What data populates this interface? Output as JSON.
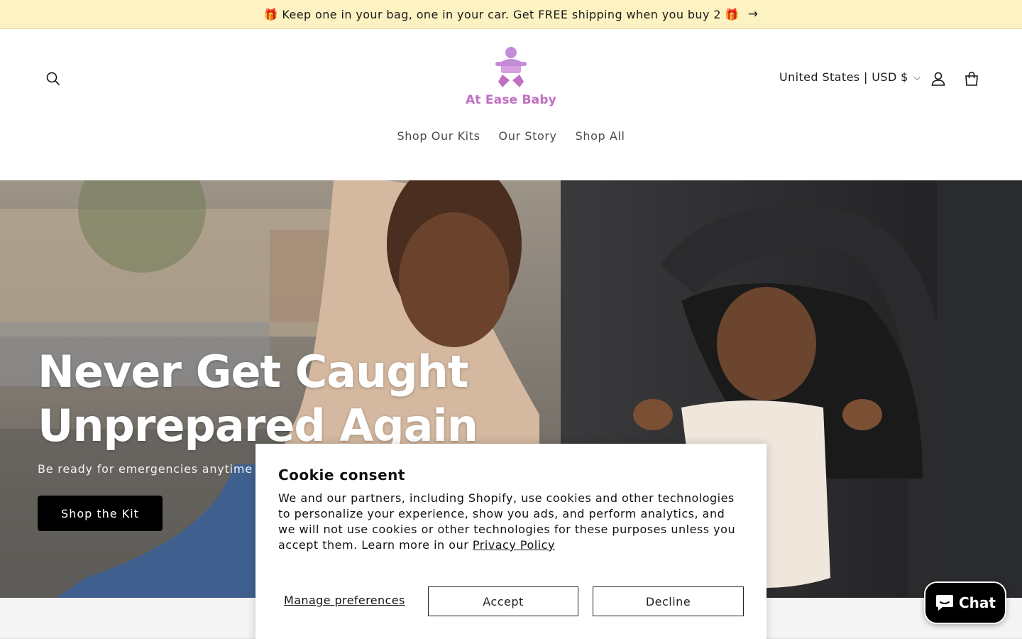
{
  "announcement": {
    "text": "🎁 Keep one in your bag, one in your car. Get FREE shipping when you buy 2 🎁",
    "arrow": "→"
  },
  "header": {
    "brand": "At Ease Baby",
    "locale": "United States | USD $",
    "icons": {
      "search": "search-icon",
      "account": "account-icon",
      "cart": "cart-icon",
      "locale_chevron": "chevron-down-icon"
    },
    "brand_color": "#c16fc1"
  },
  "nav": {
    "items": [
      {
        "label": "Shop Our Kits"
      },
      {
        "label": "Our Story"
      },
      {
        "label": "Shop All"
      }
    ]
  },
  "hero": {
    "title": "Never Get Caught Unprepared Again",
    "subtitle": "Be ready for emergencies anytime",
    "button": "Shop the Kit"
  },
  "cookie": {
    "title": "Cookie consent",
    "body": "We and our partners, including Shopify, use cookies and other technologies to personalize your experience, show you ads, and perform analytics, and we will not use cookies or other technologies for these purposes unless you accept them. Learn more in our ",
    "privacy_link": "Privacy Policy",
    "manage": "Manage preferences",
    "accept": "Accept",
    "decline": "Decline"
  },
  "chat": {
    "label": "Chat",
    "icon": "chat-bubble-icon",
    "color": "#000000"
  },
  "colors": {
    "announcement_bg": "#fdf2c2",
    "button_bg": "#000000"
  }
}
